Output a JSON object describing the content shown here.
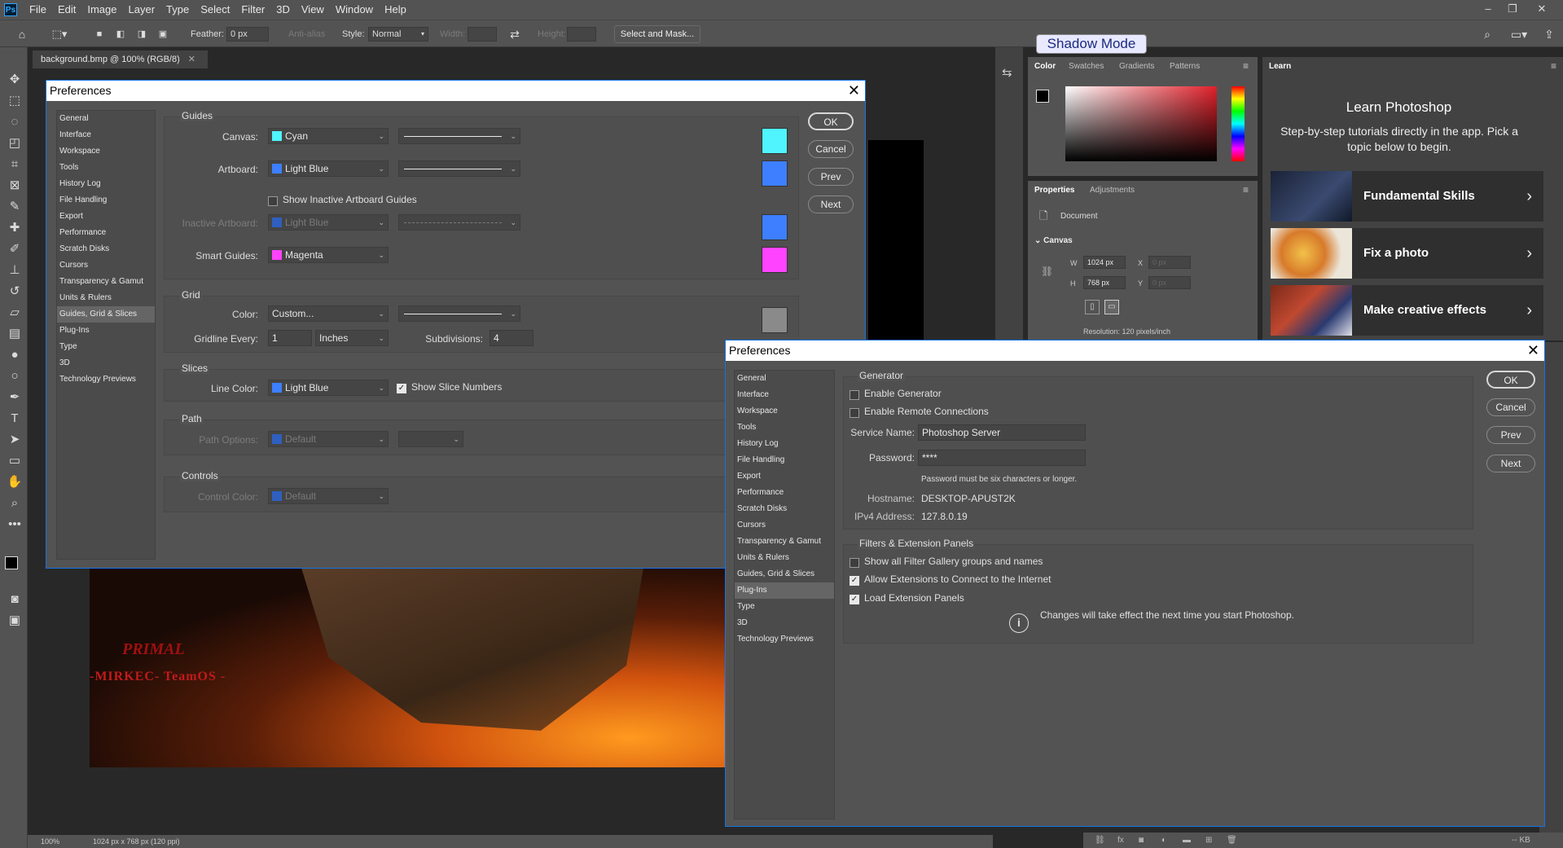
{
  "app": {
    "logo": "Ps"
  },
  "menubar": {
    "items": [
      "File",
      "Edit",
      "Image",
      "Layer",
      "Type",
      "Select",
      "Filter",
      "3D",
      "View",
      "Window",
      "Help"
    ]
  },
  "options": {
    "feather_label": "Feather:",
    "feather_value": "0 px",
    "antialias_label": "Anti-alias",
    "style_label": "Style:",
    "style_value": "Normal",
    "width_label": "Width:",
    "height_label": "Height:",
    "select_mask_label": "Select and Mask...",
    "shadow_mode_label": "Shadow Mode"
  },
  "document": {
    "tab_title": "background.bmp @ 100% (RGB/8)",
    "zoom": "100%",
    "info": "1024 px x 768 px (120 ppi)"
  },
  "canvas_art": {
    "logo_brand": "PRIMAL",
    "logo_text": "-MIRKEC- TeamOS -"
  },
  "color_panel": {
    "tabs": [
      "Color",
      "Swatches",
      "Gradients",
      "Patterns"
    ]
  },
  "properties_panel": {
    "tabs": [
      "Properties",
      "Adjustments"
    ],
    "doc_label": "Document",
    "section": "Canvas",
    "w_label": "W",
    "w_value": "1024 px",
    "h_label": "H",
    "h_value": "768 px",
    "x_label": "X",
    "x_placeholder": "0 px",
    "y_label": "Y",
    "y_placeholder": "0 px",
    "resolution": "Resolution: 120 pixels/inch"
  },
  "learn": {
    "tab": "Learn",
    "title": "Learn Photoshop",
    "subtitle": "Step-by-step tutorials directly in the app. Pick a topic below to begin.",
    "cards": [
      "Fundamental Skills",
      "Fix a photo",
      "Make creative effects"
    ]
  },
  "nav_items": [
    "General",
    "Interface",
    "Workspace",
    "Tools",
    "History Log",
    "File Handling",
    "Export",
    "Performance",
    "Scratch Disks",
    "Cursors",
    "Transparency & Gamut",
    "Units & Rulers",
    "Guides, Grid & Slices",
    "Plug-Ins",
    "Type",
    "3D",
    "Technology Previews"
  ],
  "prefs1": {
    "title": "Preferences",
    "selected_nav": "Guides, Grid & Slices",
    "guides": {
      "section": "Guides",
      "canvas_label": "Canvas:",
      "canvas_color": "Cyan",
      "canvas_hex": "#4ff4ff",
      "artboard_label": "Artboard:",
      "artboard_color": "Light Blue",
      "artboard_hex": "#3d7fff",
      "show_inactive_label": "Show Inactive Artboard Guides",
      "inactive_label": "Inactive Artboard:",
      "inactive_color": "Light Blue",
      "smart_label": "Smart Guides:",
      "smart_color": "Magenta",
      "smart_hex": "#ff43ff"
    },
    "grid": {
      "section": "Grid",
      "color_label": "Color:",
      "color_value": "Custom...",
      "color_hex": "#8a8a8a",
      "gridline_label": "Gridline Every:",
      "gridline_value": "1",
      "gridline_unit": "Inches",
      "subdiv_label": "Subdivisions:",
      "subdiv_value": "4"
    },
    "slices": {
      "section": "Slices",
      "line_label": "Line Color:",
      "line_color": "Light Blue",
      "show_numbers_label": "Show Slice Numbers",
      "show_numbers_checked": true
    },
    "path": {
      "section": "Path",
      "options_label": "Path Options:",
      "options_value": "Default"
    },
    "controls": {
      "section": "Controls",
      "color_label": "Control Color:",
      "color_value": "Default"
    },
    "buttons": {
      "ok": "OK",
      "cancel": "Cancel",
      "prev": "Prev",
      "next": "Next"
    }
  },
  "prefs2": {
    "title": "Preferences",
    "selected_nav": "Plug-Ins",
    "generator": {
      "section": "Generator",
      "enable_generator": "Enable Generator",
      "enable_remote": "Enable Remote Connections",
      "service_label": "Service Name:",
      "service_value": "Photoshop Server",
      "password_label": "Password:",
      "password_value": "****",
      "password_hint": "Password must be six characters or longer.",
      "hostname_label": "Hostname:",
      "hostname_value": "DESKTOP-APUST2K",
      "ipv4_label": "IPv4 Address:",
      "ipv4_value": "127.8.0.19"
    },
    "filters": {
      "section": "Filters & Extension Panels",
      "show_all": "Show all Filter Gallery groups and names",
      "allow_ext": "Allow Extensions to Connect to the Internet",
      "load_ext": "Load Extension Panels",
      "note": "Changes will take effect the next time you start Photoshop."
    },
    "buttons": {
      "ok": "OK",
      "cancel": "Cancel",
      "prev": "Prev",
      "next": "Next"
    }
  },
  "bottom_status": {
    "kb": "-- KB"
  },
  "colors": {
    "accent": "#1473e6",
    "ui_bg": "#535353",
    "dark_bg": "#282828"
  }
}
